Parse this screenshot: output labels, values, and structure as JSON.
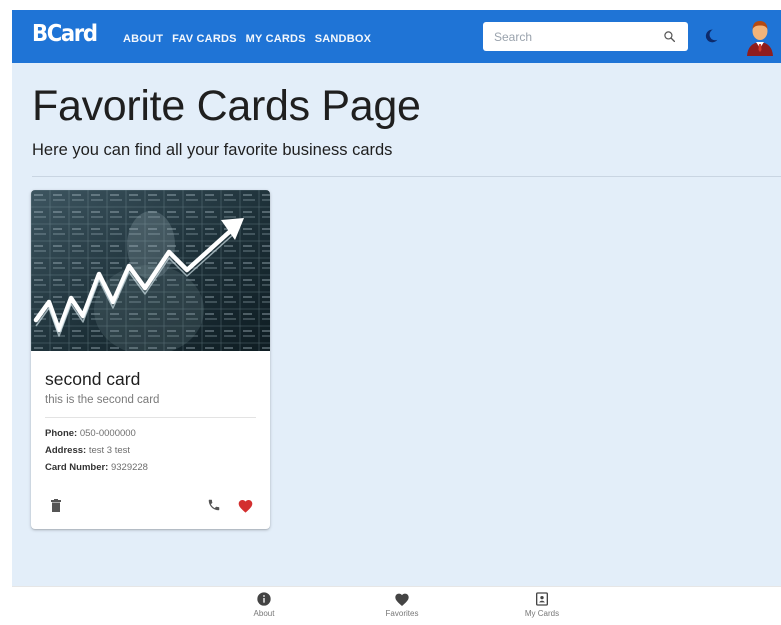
{
  "header": {
    "logo": "BCard",
    "nav": [
      "ABOUT",
      "FAV CARDS",
      "MY CARDS",
      "SANDBOX"
    ],
    "search_placeholder": "Search"
  },
  "page": {
    "title": "Favorite Cards Page",
    "subtitle": "Here you can find all your favorite business cards"
  },
  "cards": [
    {
      "title": "second card",
      "subtitle": "this is the second card",
      "phone_label": "Phone:",
      "phone": "050-0000000",
      "address_label": "Address:",
      "address": "test 3 test",
      "number_label": "Card Number:",
      "number": "9329228",
      "favorite": true
    }
  ],
  "bottom_nav": [
    {
      "label": "About",
      "icon": "info-icon"
    },
    {
      "label": "Favorites",
      "icon": "heart-icon"
    },
    {
      "label": "My Cards",
      "icon": "contact-card-icon"
    }
  ],
  "colors": {
    "appbar": "#1f74d6",
    "background": "#e3eef9",
    "favorite": "#d32f2f",
    "icon": "#555555"
  }
}
